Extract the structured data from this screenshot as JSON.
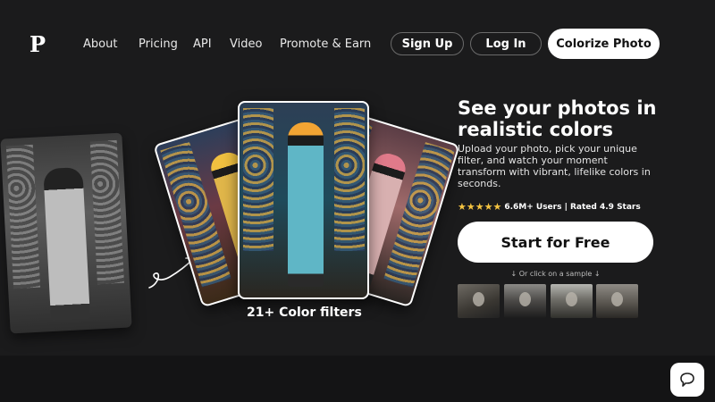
{
  "nav": {
    "logo": "P",
    "links": [
      "About",
      "Pricing",
      "API",
      "Video",
      "Promote & Earn"
    ],
    "signup_label": "Sign Up",
    "login_label": "Log In",
    "colorize_label": "Colorize Photo"
  },
  "showcase": {
    "caption": "21+ Color filters"
  },
  "hero": {
    "title": "See your photos in realistic colors",
    "subtitle": "Upload your photo, pick your unique filter, and watch your moment transform with vibrant, lifelike colors in seconds.",
    "stars": "★★★★★",
    "rating_text": "6.6M+ Users | Rated 4.9 Stars",
    "star_color": "#f5c441",
    "cta_label": "Start for Free",
    "sample_hint": "↓ Or click on a sample ↓"
  },
  "samples": [
    "sample-photo-1",
    "sample-photo-2",
    "sample-photo-3",
    "sample-photo-4"
  ],
  "chat": {
    "icon": "chat-bubble-icon"
  },
  "colors": {
    "background": "#1b1b1c",
    "button_bg": "#ffffff",
    "button_text": "#111111"
  }
}
